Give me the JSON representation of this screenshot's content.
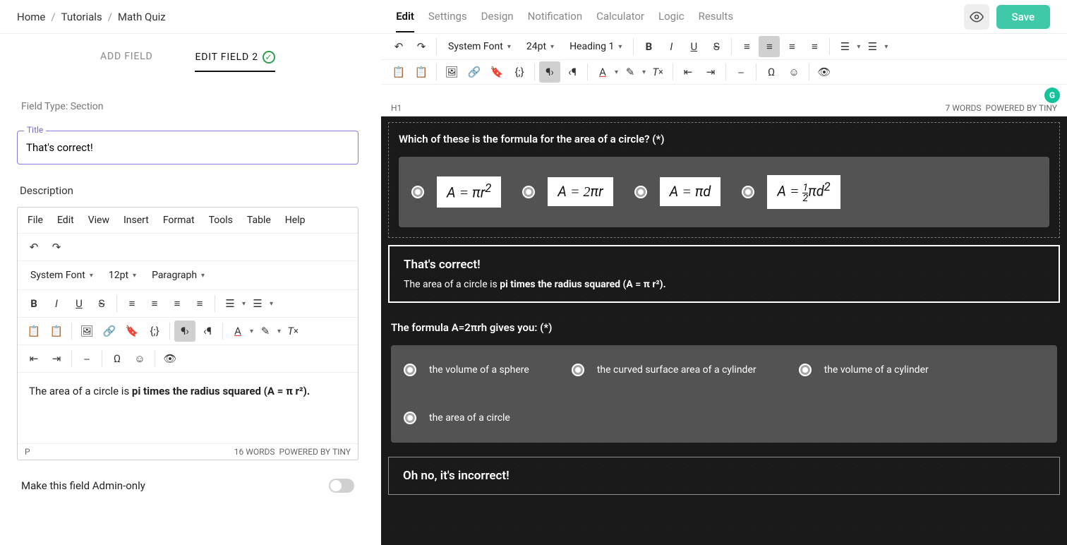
{
  "breadcrumb": [
    "Home",
    "Tutorials",
    "Math Quiz"
  ],
  "nav": [
    "Edit",
    "Settings",
    "Design",
    "Notification",
    "Calculator",
    "Logic",
    "Results"
  ],
  "nav_active": 0,
  "save_label": "Save",
  "left": {
    "tabs": {
      "add": "ADD FIELD",
      "edit": "EDIT FIELD 2"
    },
    "field_type": "Field Type: Section",
    "title_label": "Title",
    "title_value": "That's correct!",
    "desc_label": "Description",
    "menubar": [
      "File",
      "Edit",
      "View",
      "Insert",
      "Format",
      "Tools",
      "Table",
      "Help"
    ],
    "font": "System Font",
    "size": "12pt",
    "para": "Paragraph",
    "content_prefix": "The area of a circle is ",
    "content_bold": "pi times the radius squared (A = π r²).",
    "status_left": "P",
    "status_words": "16 WORDS",
    "status_poweredby": "POWERED BY TINY",
    "admin_label": "Make this field Admin-only"
  },
  "right_toolbar": {
    "font": "System Font",
    "size": "24pt",
    "style": "Heading 1",
    "status_left": "H1",
    "status_words": "7 WORDS",
    "status_poweredby": "POWERED BY TINY"
  },
  "preview": {
    "q1": {
      "title": "Which of these is the formula for the area of a circle? (*)",
      "opts": [
        "A = πr²",
        "A = 2πr",
        "A = πd",
        "A = ½πd²"
      ]
    },
    "feedback_correct": {
      "title": "That's correct!",
      "desc_prefix": "The area of a circle is ",
      "desc_bold": "pi times the radius squared (A = π r²)."
    },
    "q2": {
      "title": "The formula A=2πrh gives you: (*)",
      "opts": [
        "the volume of a sphere",
        "the curved surface area of a cylinder",
        "the volume of a cylinder",
        "the area of a circle"
      ]
    },
    "feedback_incorrect": {
      "title": "Oh no, it's incorrect!"
    }
  }
}
